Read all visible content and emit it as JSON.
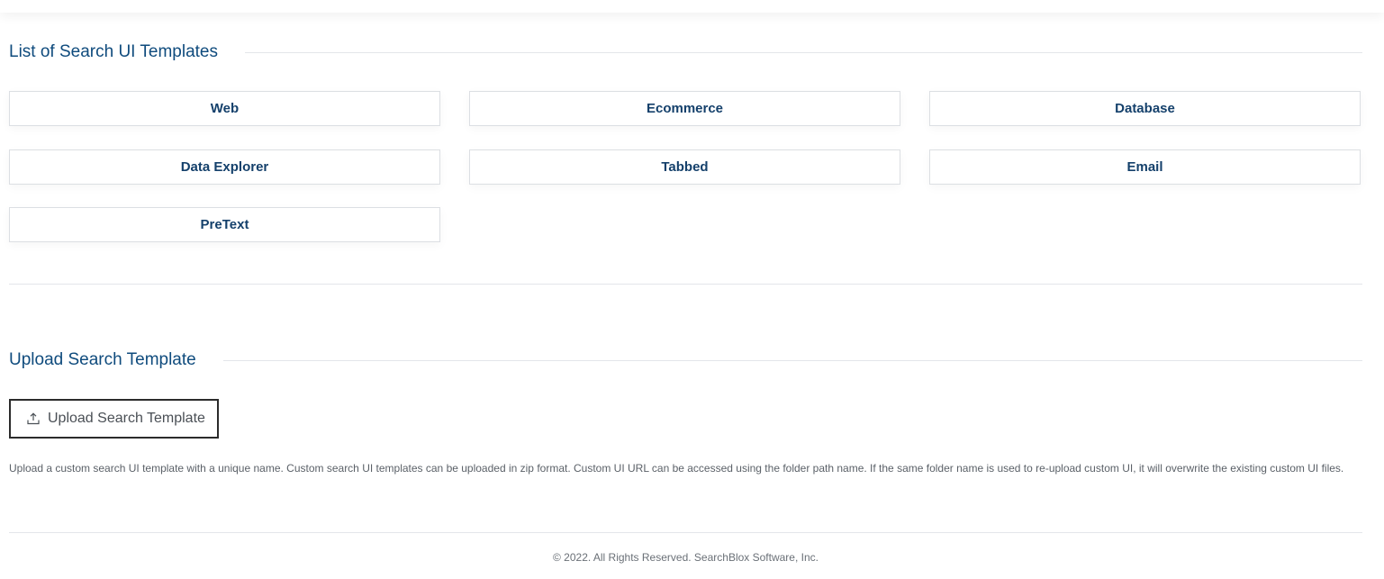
{
  "templates_section": {
    "title": "List of Search UI Templates",
    "templates": [
      {
        "label": "Web"
      },
      {
        "label": "Ecommerce"
      },
      {
        "label": "Database"
      },
      {
        "label": "Data Explorer"
      },
      {
        "label": "Tabbed"
      },
      {
        "label": "Email"
      },
      {
        "label": "PreText"
      }
    ]
  },
  "upload_section": {
    "title": "Upload Search Template",
    "button_label": "Upload Search Template",
    "button_icon": "upload-icon",
    "help_text": "Upload a custom search UI template with a unique name. Custom search UI templates can be uploaded in zip format. Custom UI URL can be accessed using the folder path name. If the same folder name is used to re-upload custom UI, it will overwrite the existing custom UI files."
  },
  "footer": {
    "copyright": "© 2022. All Rights Reserved. SearchBlox Software, Inc."
  },
  "colors": {
    "heading": "#0f4b7d",
    "button_text": "#14406b",
    "border": "#dcdfe3"
  }
}
